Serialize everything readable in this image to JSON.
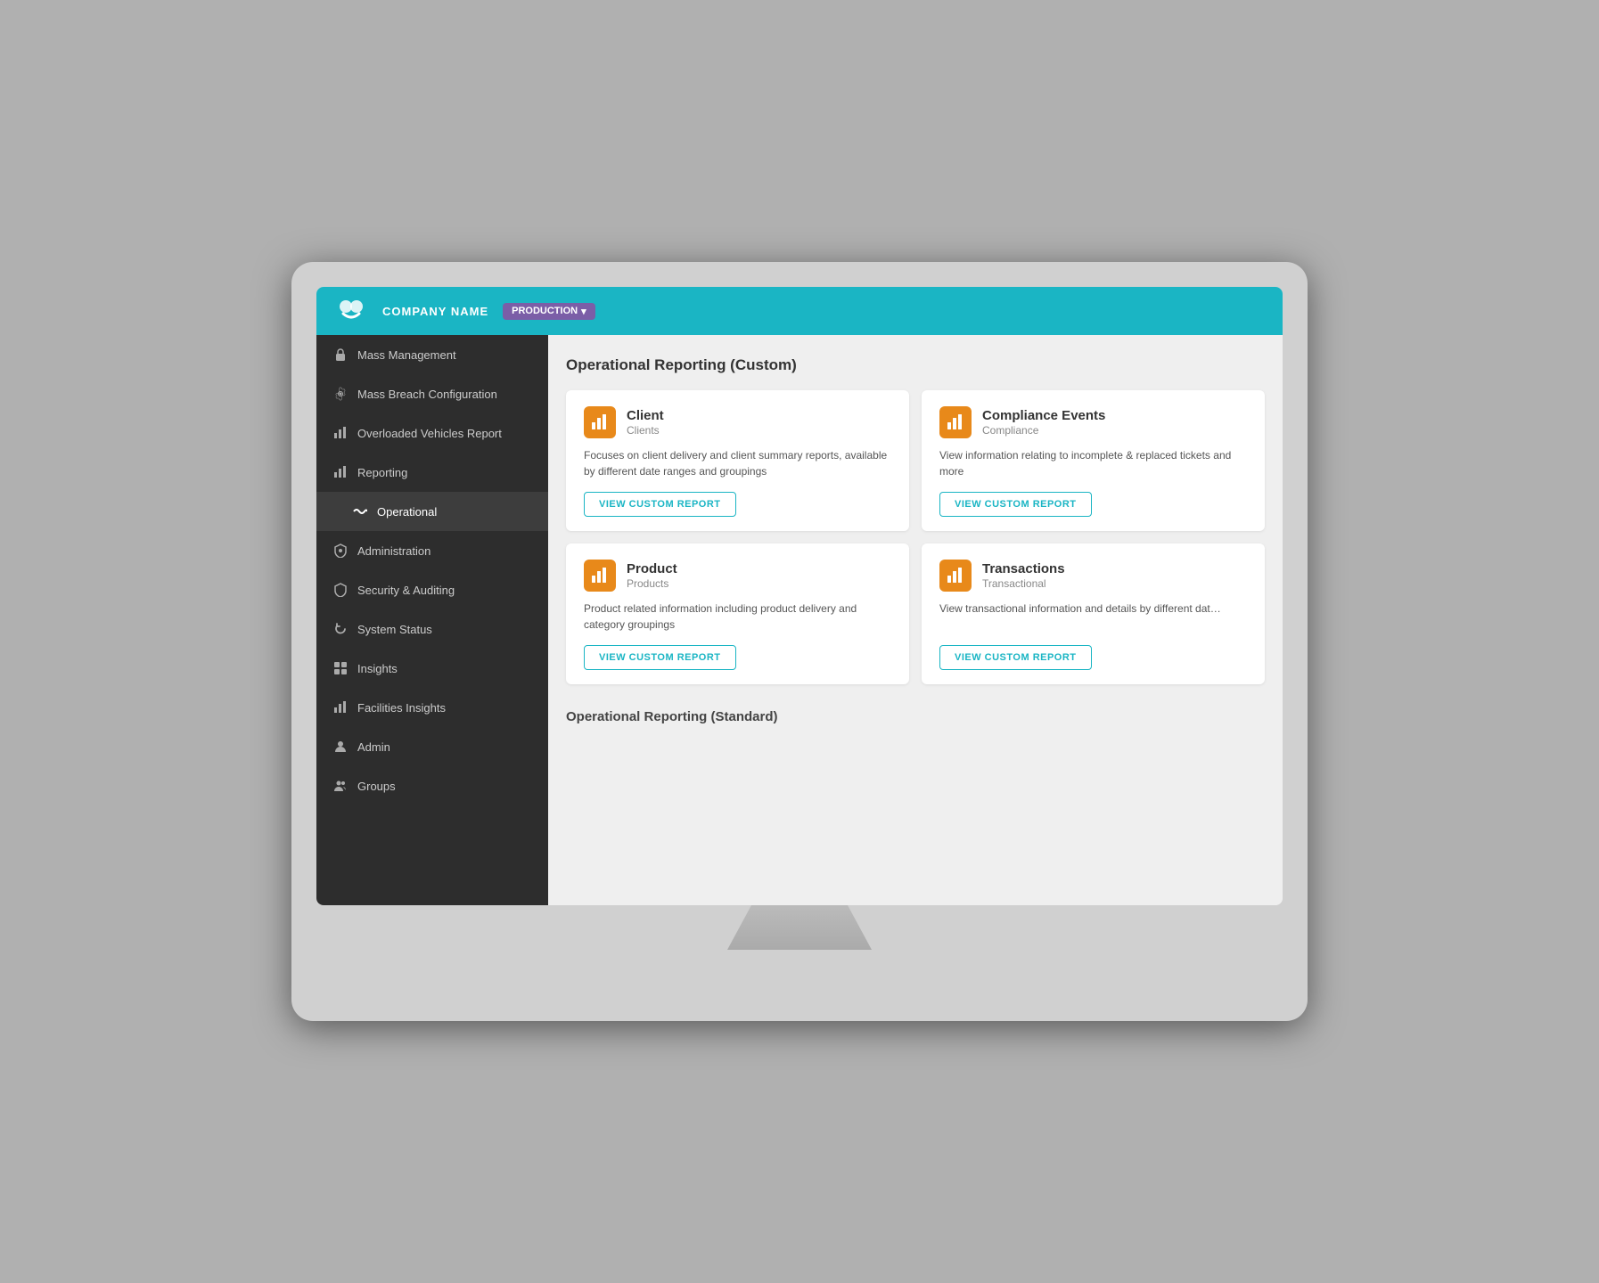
{
  "topNav": {
    "companyName": "COMPANY NAME",
    "envLabel": "PRODUCTION",
    "envDropdownIcon": "▾"
  },
  "sidebar": {
    "items": [
      {
        "id": "mass-management",
        "label": "Mass Management",
        "icon": "lock",
        "level": 0
      },
      {
        "id": "mass-breach-config",
        "label": "Mass Breach Configuration",
        "icon": "gear",
        "level": 0
      },
      {
        "id": "overloaded-vehicles",
        "label": "Overloaded Vehicles Report",
        "icon": "bar-chart",
        "level": 0
      },
      {
        "id": "reporting",
        "label": "Reporting",
        "icon": "bar-chart",
        "level": 0
      },
      {
        "id": "operational",
        "label": "Operational",
        "icon": "wave",
        "level": 1,
        "active": true
      },
      {
        "id": "administration",
        "label": "Administration",
        "icon": "shield-gear",
        "level": 0
      },
      {
        "id": "security-auditing",
        "label": "Security & Auditing",
        "icon": "shield",
        "level": 0
      },
      {
        "id": "system-status",
        "label": "System Status",
        "icon": "refresh",
        "level": 0
      },
      {
        "id": "insights",
        "label": "Insights",
        "icon": "grid",
        "level": 0
      },
      {
        "id": "facilities-insights",
        "label": "Facilities Insights",
        "icon": "bar-chart",
        "level": 0
      },
      {
        "id": "admin",
        "label": "Admin",
        "icon": "person",
        "level": 0
      },
      {
        "id": "groups",
        "label": "Groups",
        "icon": "people",
        "level": 0
      }
    ]
  },
  "content": {
    "sectionTitle": "Operational Reporting (Custom)",
    "cards": [
      {
        "id": "client",
        "title": "Client",
        "subtitle": "Clients",
        "description": "Focuses on client delivery and client summary reports, available by different date ranges and groupings",
        "buttonLabel": "VIEW CUSTOM REPORT"
      },
      {
        "id": "compliance-events",
        "title": "Compliance Events",
        "subtitle": "Compliance",
        "description": "View information relating to incomplete & replaced tickets and more",
        "buttonLabel": "VIEW CUSTOM REPORT"
      },
      {
        "id": "product",
        "title": "Product",
        "subtitle": "Products",
        "description": "Product related information including product delivery and category groupings",
        "buttonLabel": "VIEW CUSTOM REPORT"
      },
      {
        "id": "transactions",
        "title": "Transactions",
        "subtitle": "Transactional",
        "description": "View transactional information and details by different dat…",
        "buttonLabel": "VIEW CUSTOM REPORT"
      }
    ],
    "nextSectionTitle": "Operational Reporting (Standard)"
  }
}
